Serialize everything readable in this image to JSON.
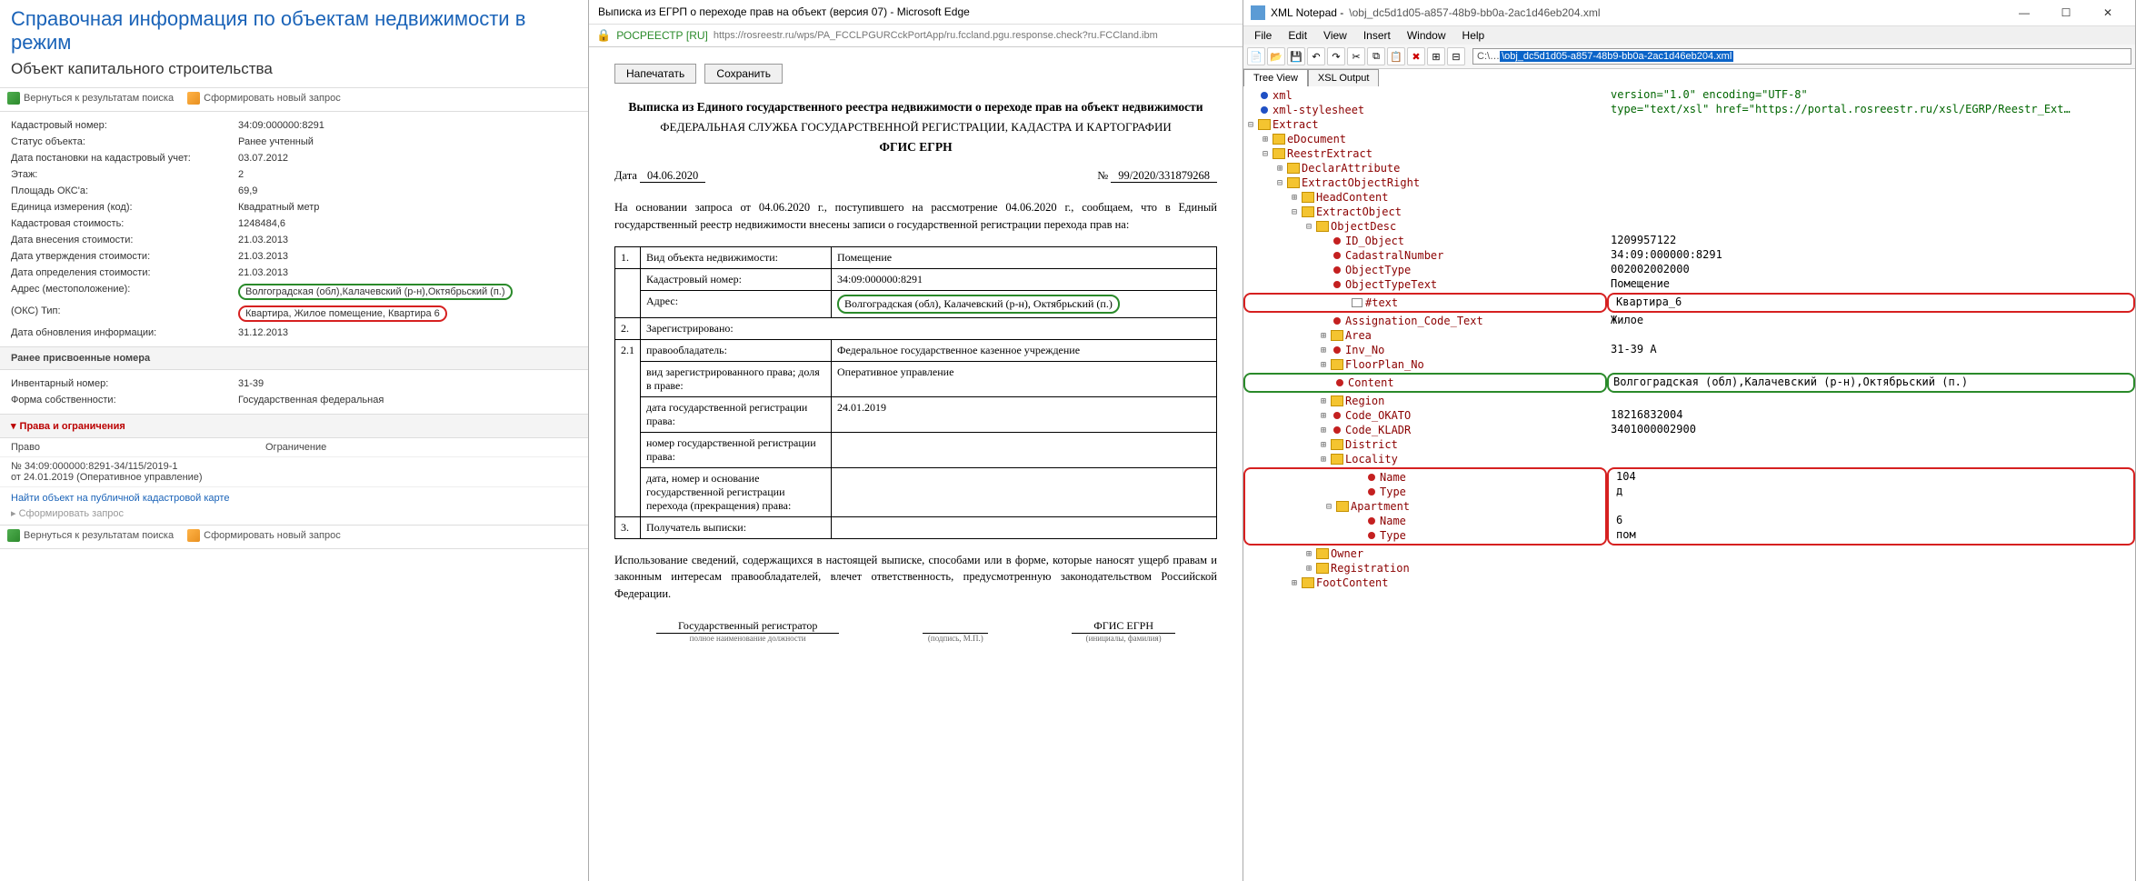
{
  "left": {
    "title": "Справочная информация по объектам недвижимости в режим",
    "subtitle": "Объект капитального строительства",
    "tb_back": "Вернуться к результатам поиска",
    "tb_new": "Сформировать новый запрос",
    "rows": [
      {
        "l": "Кадастровый номер:",
        "v": "34:09:000000:8291"
      },
      {
        "l": "Статус объекта:",
        "v": "Ранее учтенный"
      },
      {
        "l": "Дата постановки на кадастровый учет:",
        "v": "03.07.2012"
      },
      {
        "l": "Этаж:",
        "v": "2"
      },
      {
        "l": "Площадь ОКС'а:",
        "v": "69,9"
      },
      {
        "l": "Единица измерения (код):",
        "v": "Квадратный метр"
      },
      {
        "l": "Кадастровая стоимость:",
        "v": "1248484,6"
      },
      {
        "l": "Дата внесения стоимости:",
        "v": "21.03.2013"
      },
      {
        "l": "Дата утверждения стоимости:",
        "v": "21.03.2013"
      },
      {
        "l": "Дата определения стоимости:",
        "v": "21.03.2013"
      },
      {
        "l": "Адрес (местоположение):",
        "v": "Волгоградская (обл),Калачевский (р-н),Октябрьский (п.)",
        "hl": "g"
      },
      {
        "l": "(ОКС) Тип:",
        "v": "Квартира, Жилое помещение, Квартира 6",
        "hl": "r"
      },
      {
        "l": "Дата обновления информации:",
        "v": "31.12.2013"
      }
    ],
    "sec_prev": "Ранее присвоенные номера",
    "rows2": [
      {
        "l": "Инвентарный номер:",
        "v": "31-39"
      },
      {
        "l": "Форма собственности:",
        "v": "Государственная федеральная"
      }
    ],
    "sec_rights": "Права и ограничения",
    "col_right": "Право",
    "col_lim": "Ограничение",
    "right_num": "№ 34:09:000000:8291-34/115/2019-1",
    "right_date": "от 24.01.2019  (Оперативное управление)",
    "link_find": "Найти объект на публичной кадастровой карте",
    "link_form": "Сформировать запрос"
  },
  "mid": {
    "wintitle": "Выписка из ЕГРП о переходе прав на объект (версия 07) - Microsoft Edge",
    "site": "РОСРЕЕСТР [RU]",
    "url": "https://rosreestr.ru/wps/PA_FCCLPGURCckPortApp/ru.fccland.pgu.response.check?ru.FCCland.ibm",
    "btn_print": "Напечатать",
    "btn_save": "Сохранить",
    "h1": "Выписка из Единого государственного реестра недвижимости о переходе прав на объект недвижимости",
    "h2": "ФЕДЕРАЛЬНАЯ СЛУЖБА ГОСУДАРСТВЕННОЙ РЕГИСТРАЦИИ, КАДАСТРА И КАРТОГРАФИИ",
    "h3": "ФГИС ЕГРН",
    "date_lbl": "Дата",
    "date_val": "04.06.2020",
    "num_lbl": "№",
    "num_val": "99/2020/331879268",
    "para1": "На основании запроса от 04.06.2020 г., поступившего на рассмотрение 04.06.2020 г., сообщаем, что в Единый государственный реестр недвижимости внесены записи о государственной регистрации перехода прав на:",
    "tbl": {
      "r1a": "1.",
      "r1b": "Вид объекта недвижимости:",
      "r1c": "Помещение",
      "r2b": "Кадастровый номер:",
      "r2c": "34:09:000000:8291",
      "r3b": "Адрес:",
      "r3c": "Волгоградская (обл), Калачевский (р-н), Октябрьский (п.)",
      "r4a": "2.",
      "r4b": "Зарегистрировано:",
      "r5a": "2.1",
      "r5b": "правообладатель:",
      "r5c": "Федеральное государственное казенное учреждение",
      "r6b": "вид зарегистрированного права; доля в праве:",
      "r6c": "Оперативное управление",
      "r7b": "дата государственной регистрации права:",
      "r7c": "24.01.2019",
      "r8b": "номер государственной регистрации права:",
      "r9b": "дата, номер и основание государственной регистрации перехода (прекращения) права:",
      "r10a": "3.",
      "r10b": "Получатель выписки:"
    },
    "para2": "Использование сведений, содержащихся в настоящей выписке, способами или в форме, которые наносят ущерб правам и законным интересам правообладателей, влечет ответственность, предусмотренную законодательством Российской Федерации.",
    "sig1": "Государственный регистратор",
    "sig1s": "полное наименование должности",
    "sig2": "(подпись, М.П.)",
    "sig3": "ФГИС ЕГРН",
    "sig3s": "(инициалы, фамилия)"
  },
  "right": {
    "app": "XML Notepad - ",
    "file": "\\obj_dc5d1d05-a857-48b9-bb0a-2ac1d46eb204.xml",
    "menu": [
      "File",
      "Edit",
      "View",
      "Insert",
      "Window",
      "Help"
    ],
    "pathsel": "\\obj_dc5d1d05-a857-48b9-bb0a-2ac1d46eb204.xml",
    "tab1": "Tree View",
    "tab2": "XSL Output",
    "val_version": "version=\"1.0\" encoding=\"UTF-8\"",
    "val_xsl": "type=\"text/xsl\" href=\"https://portal.rosreestr.ru/xsl/EGRP/Reestr_Ext…",
    "vals": {
      "id": "1209957122",
      "cad": "34:09:000000:8291",
      "ot": "002002002000",
      "ott": "Помещение",
      "text": "Квартира_6",
      "assign": "Жилое",
      "inv": "31-39 А",
      "content": "Волгоградская (обл),Калачевский (р-н),Октябрьский (п.)",
      "okato": "18216832004",
      "kladr": "3401000002900",
      "locname": "104",
      "loctype": "д",
      "aptname": "6",
      "apttype": "пом"
    },
    "nodes": {
      "xml": "xml",
      "xsl": "xml-stylesheet",
      "extract": "Extract",
      "edoc": "eDocument",
      "rex": "ReestrExtract",
      "decl": "DeclarAttribute",
      "eor": "ExtractObjectRight",
      "head": "HeadContent",
      "eo": "ExtractObject",
      "od": "ObjectDesc",
      "ido": "ID_Object",
      "cn": "CadastralNumber",
      "ot": "ObjectType",
      "ott": "ObjectTypeText",
      "txt": "#text",
      "act": "Assignation_Code_Text",
      "area": "Area",
      "inv": "Inv_No",
      "fp": "FloorPlan_No",
      "cont": "Content",
      "reg": "Region",
      "okato": "Code_OKATO",
      "kladr": "Code_KLADR",
      "dist": "District",
      "loc": "Locality",
      "name": "Name",
      "type": "Type",
      "apt": "Apartment",
      "owner": "Owner",
      "regn": "Registration",
      "foot": "FootContent"
    }
  }
}
